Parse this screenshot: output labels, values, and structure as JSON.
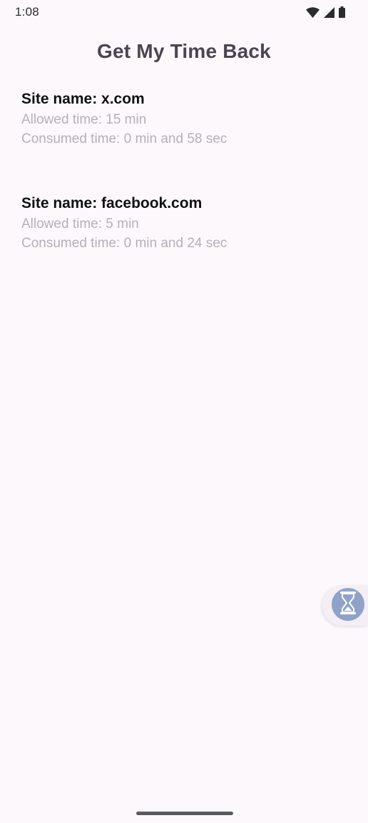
{
  "status_bar": {
    "time": "1:08"
  },
  "title": "Get My Time Back",
  "sites": [
    {
      "name_line": "Site name: x.com",
      "allowed_line": "Allowed time: 15 min",
      "consumed_line": "Consumed time: 0 min and 58 sec"
    },
    {
      "name_line": "Site name: facebook.com",
      "allowed_line": "Allowed time: 5 min",
      "consumed_line": "Consumed time: 0 min and 24 sec"
    }
  ],
  "floating_button": {
    "icon": "hourglass-icon",
    "color": "#8fa3c8"
  },
  "colors": {
    "background": "#fcf8fc",
    "title": "#4a4550",
    "site_name": "#111111",
    "detail": "#b4b0b8"
  }
}
